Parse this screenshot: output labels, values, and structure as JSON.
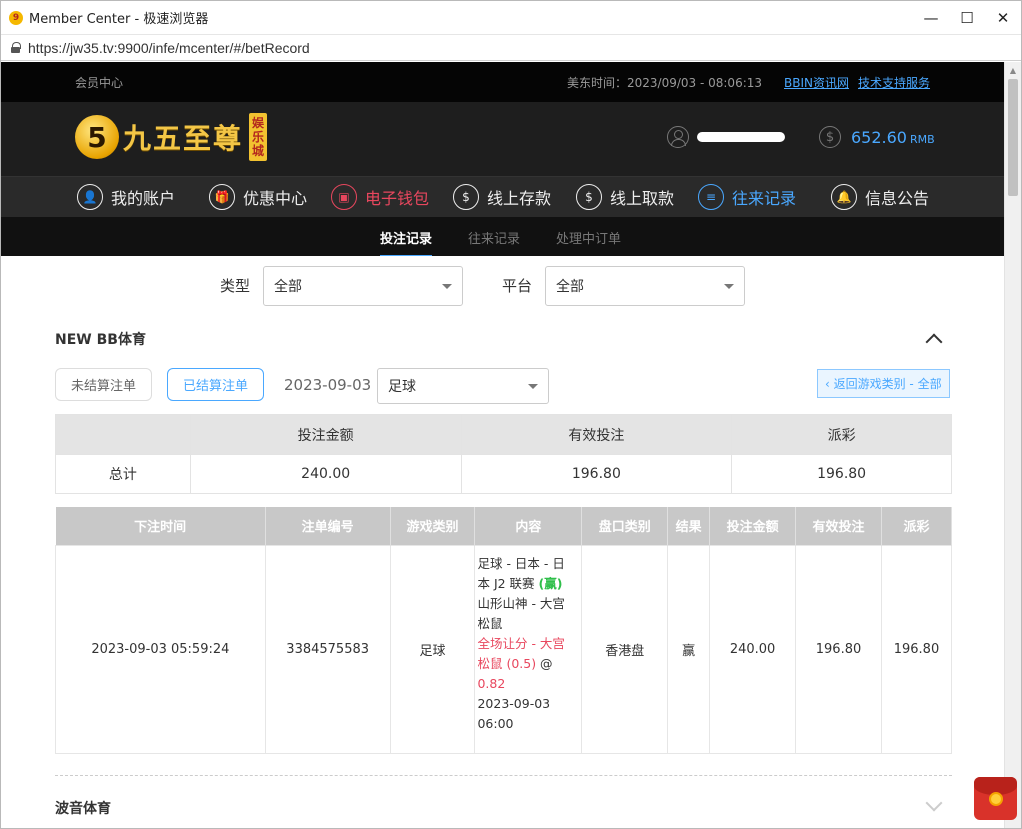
{
  "window": {
    "title": "Member Center - 极速浏览器",
    "url": "https://jw35.tv:9900/infe/mcenter/#/betRecord",
    "app_icon_glyph": "9"
  },
  "topbar": {
    "member_center": "会员中心",
    "time": "美东时间：2023/09/03 - 08:06:13",
    "link_news": "BBIN资讯网",
    "link_support": "技术支持服务"
  },
  "header": {
    "logo_glyph": "5",
    "logo_text": "九五至尊",
    "logo_badge": [
      "娱",
      "乐",
      "城"
    ],
    "balance": "652.60",
    "currency": "RMB",
    "coin_glyph": "$"
  },
  "nav": [
    {
      "label": "我的账户",
      "icon": "user-icon",
      "glyph": "👤"
    },
    {
      "label": "优惠中心",
      "icon": "gift-icon",
      "glyph": "🎁"
    },
    {
      "label": "电子钱包",
      "icon": "wallet-icon",
      "glyph": "▣"
    },
    {
      "label": "线上存款",
      "icon": "deposit-icon",
      "glyph": "$"
    },
    {
      "label": "线上取款",
      "icon": "withdraw-icon",
      "glyph": "$"
    },
    {
      "label": "往来记录",
      "icon": "record-icon",
      "glyph": "≡"
    },
    {
      "label": "信息公告",
      "icon": "bell-icon",
      "glyph": "🔔"
    }
  ],
  "subnav": [
    "投注记录",
    "往来记录",
    "处理中订单"
  ],
  "filters": {
    "type_label": "类型",
    "type_value": "全部",
    "platform_label": "平台",
    "platform_value": "全部"
  },
  "section": {
    "title": "NEW BB体育",
    "unsettled": "未结算注单",
    "settled": "已结算注单",
    "date": "2023-09-03",
    "sport": "足球",
    "back": "‹ 返回游戏类别 - 全部"
  },
  "summary": {
    "headers": [
      "",
      "投注金额",
      "有效投注",
      "派彩"
    ],
    "row": [
      "总计",
      "240.00",
      "196.80",
      "196.80"
    ]
  },
  "records": {
    "headers": [
      "下注时间",
      "注单编号",
      "游戏类别",
      "内容",
      "盘口类别",
      "结果",
      "投注金额",
      "有效投注",
      "派彩"
    ],
    "row": {
      "time": "2023-09-03 05:59:24",
      "order_no": "3384575583",
      "game": "足球",
      "content_line1": "足球 - 日本 - 日本 J2 联赛 ",
      "content_win": "(赢)",
      "content_line2": "山形山神 - 大宫松鼠",
      "content_bet": "全场让分 - 大宫松鼠 (0.5)",
      "content_at": " @ ",
      "content_odds": "0.82",
      "content_time": "2023-09-03 06:00",
      "handicap": "香港盘",
      "result": "赢",
      "bet_amount": "240.00",
      "valid_bet": "196.80",
      "payout": "196.80"
    }
  },
  "section2": {
    "title": "波音体育"
  },
  "colors": {
    "accent": "#4aa8ff",
    "red": "#e8475e",
    "win": "#2fbf4a"
  }
}
